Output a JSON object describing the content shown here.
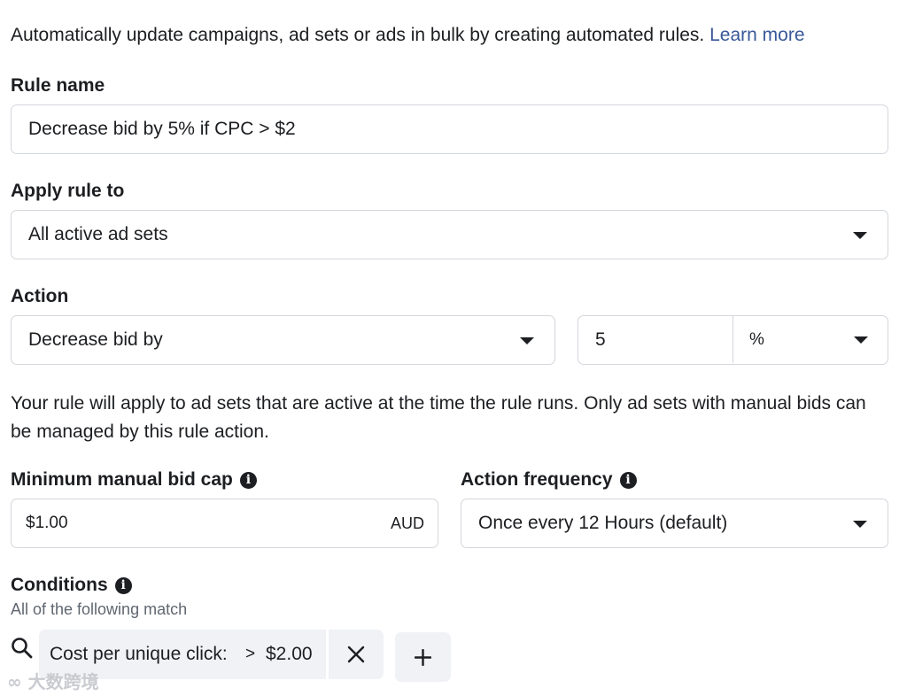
{
  "intro": {
    "text": "Automatically update campaigns, ad sets or ads in bulk by creating automated rules.",
    "link": "Learn more"
  },
  "rule_name": {
    "label": "Rule name",
    "value": "Decrease bid by 5% if CPC > $2"
  },
  "apply_rule": {
    "label": "Apply rule to",
    "selected": "All active ad sets"
  },
  "action": {
    "label": "Action",
    "selected": "Decrease bid by",
    "amount": "5",
    "unit": "%"
  },
  "help_text": "Your rule will apply to ad sets that are active at the time the rule runs. Only ad sets with manual bids can be managed by this rule action.",
  "min_bid_cap": {
    "label": "Minimum manual bid cap",
    "value": "$1.00",
    "currency": "AUD"
  },
  "action_frequency": {
    "label": "Action frequency",
    "selected": "Once every 12 Hours (default)"
  },
  "conditions": {
    "label": "Conditions",
    "subtitle": "All of the following match",
    "items": [
      {
        "metric": "Cost per unique click:",
        "operator": ">",
        "value": "$2.00"
      }
    ]
  },
  "watermark": "大数跨境",
  "icons": {
    "info": "info-icon",
    "search": "search-icon",
    "remove": "close-icon",
    "add": "plus-icon",
    "dropdown": "caret-down-icon"
  }
}
